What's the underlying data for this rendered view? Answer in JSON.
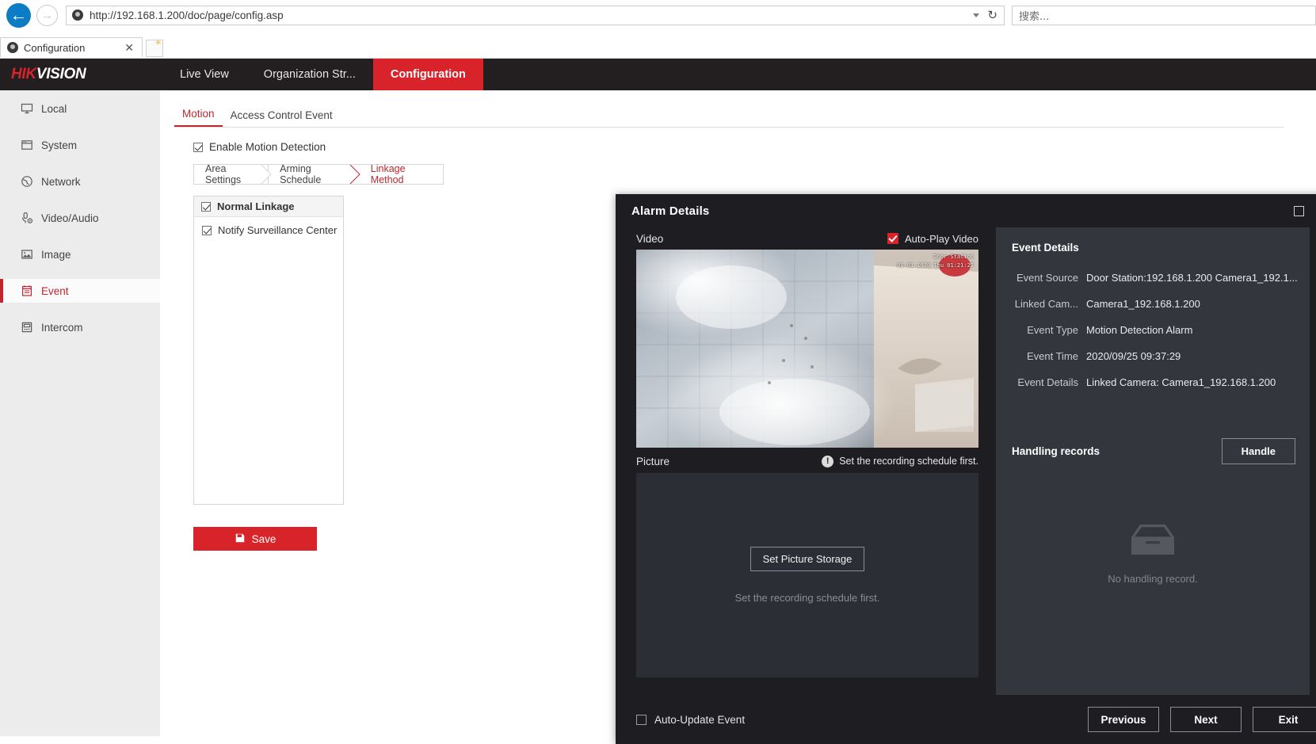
{
  "browser": {
    "back_icon": "back-arrow-icon",
    "forward_icon": "forward-arrow-icon",
    "url": "http://192.168.1.200/doc/page/config.asp",
    "reload_icon": "↻",
    "search_placeholder": "搜索...",
    "tab_title": "Configuration",
    "tab_close": "✕"
  },
  "header": {
    "logo_hik": "HIK",
    "logo_vision": "VISION",
    "nav": [
      {
        "label": "Live View",
        "active": false
      },
      {
        "label": "Organization Str...",
        "active": false
      },
      {
        "label": "Configuration",
        "active": true
      }
    ]
  },
  "sidebar": {
    "items": [
      {
        "label": "Local",
        "icon": "monitor-icon",
        "active": false
      },
      {
        "label": "System",
        "icon": "window-icon",
        "active": false
      },
      {
        "label": "Network",
        "icon": "globe-icon",
        "active": false
      },
      {
        "label": "Video/Audio",
        "icon": "microphone-icon",
        "active": false
      },
      {
        "label": "Image",
        "icon": "picture-icon",
        "active": false
      },
      {
        "label": "Event",
        "icon": "calendar-icon",
        "active": true
      },
      {
        "label": "Intercom",
        "icon": "intercom-icon",
        "active": false
      }
    ]
  },
  "main": {
    "tabs": [
      {
        "label": "Motion",
        "active": true
      },
      {
        "label": "Access Control Event",
        "active": false
      }
    ],
    "enable_motion_label": "Enable Motion Detection",
    "enable_motion_checked": true,
    "steps": [
      {
        "label": "Area Settings",
        "active": false
      },
      {
        "label": "Arming Schedule",
        "active": false
      },
      {
        "label": "Linkage Method",
        "active": true
      }
    ],
    "linkage": {
      "header_label": "Normal Linkage",
      "header_checked": true,
      "items": [
        {
          "label": "Notify Surveillance Center",
          "checked": true
        }
      ]
    },
    "save_label": "Save",
    "save_icon": "floppy-disk-icon",
    "save_color": "#d8232a"
  },
  "modal": {
    "title": "Alarm Details",
    "maximize_icon": "maximize-icon",
    "close_icon": "✕",
    "video_label": "Video",
    "autoplay_label": "Auto-Play Video",
    "autoplay_checked": true,
    "video_osd_line1": "Door Station",
    "video_osd_line2": "01-01-1970 Thu 01:21:27",
    "picture_label": "Picture",
    "picture_warning": "Set the recording schedule first.",
    "warning_icon": "!",
    "set_picture_storage_label": "Set Picture Storage",
    "picture_hint": "Set the recording schedule first.",
    "event_details_title": "Event Details",
    "event_details_rows": [
      {
        "key": "Event Source",
        "value": "Door Station:192.168.1.200 Camera1_192.1..."
      },
      {
        "key": "Linked Cam...",
        "value": "Camera1_192.168.1.200"
      },
      {
        "key": "Event Type",
        "value": "Motion Detection Alarm"
      },
      {
        "key": "Event Time",
        "value": "2020/09/25 09:37:29"
      },
      {
        "key": "Event Details",
        "value": "Linked Camera: Camera1_192.168.1.200"
      }
    ],
    "handling_records_title": "Handling records",
    "handle_button_label": "Handle",
    "empty_icon": "empty-tray-icon",
    "empty_text": "No handling record.",
    "auto_update_label": "Auto-Update Event",
    "auto_update_checked": false,
    "footer_buttons": [
      {
        "label": "Previous"
      },
      {
        "label": "Next"
      },
      {
        "label": "Exit"
      }
    ]
  }
}
